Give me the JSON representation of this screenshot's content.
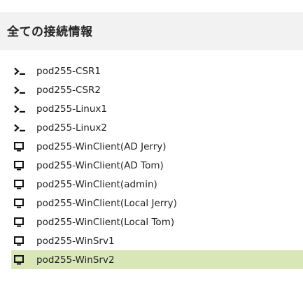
{
  "header": {
    "title": "全ての接続情報"
  },
  "connections": [
    {
      "label": "pod255-CSR1",
      "icon": "terminal-icon"
    },
    {
      "label": "pod255-CSR2",
      "icon": "terminal-icon"
    },
    {
      "label": "pod255-Linux1",
      "icon": "terminal-icon"
    },
    {
      "label": "pod255-Linux2",
      "icon": "terminal-icon"
    },
    {
      "label": "pod255-WinClient(AD Jerry)",
      "icon": "monitor-icon"
    },
    {
      "label": "pod255-WinClient(AD Tom)",
      "icon": "monitor-icon"
    },
    {
      "label": "pod255-WinClient(admin)",
      "icon": "monitor-icon"
    },
    {
      "label": "pod255-WinClient(Local Jerry)",
      "icon": "monitor-icon"
    },
    {
      "label": "pod255-WinClient(Local Tom)",
      "icon": "monitor-icon"
    },
    {
      "label": "pod255-WinSrv1",
      "icon": "monitor-icon"
    },
    {
      "label": "pod255-WinSrv2",
      "icon": "monitor-icon",
      "selected": true
    }
  ],
  "colors": {
    "header_bg": "#f2f2f2",
    "selected_bg": "#d9e6b8",
    "text": "#222222"
  }
}
